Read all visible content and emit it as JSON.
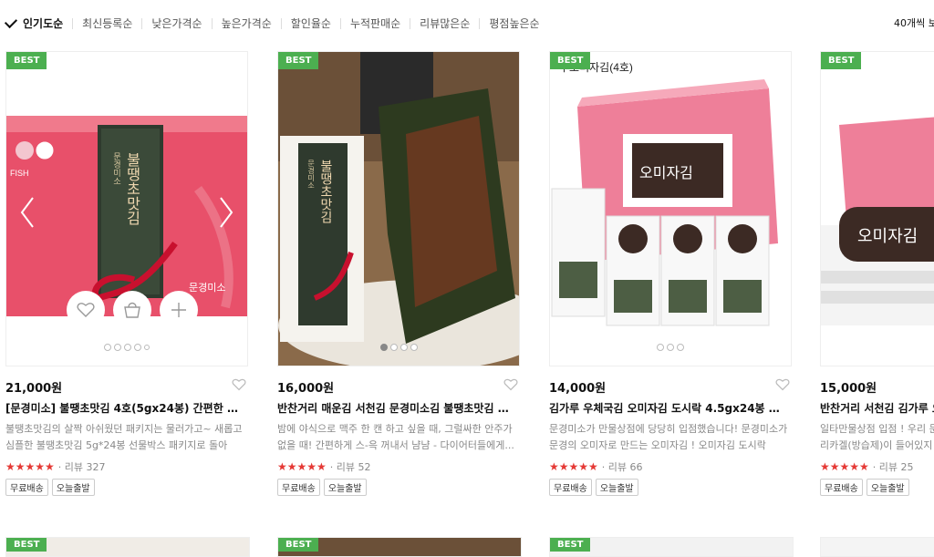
{
  "sort": {
    "items": [
      "인기도순",
      "최신등록순",
      "낮은가격순",
      "높은가격순",
      "할인율순",
      "누적판매순",
      "리뷰많은순",
      "평점높은순"
    ],
    "perpage": "40개씩 보"
  },
  "badge_label": "BEST",
  "colors": {
    "badge": "#4caf50",
    "stars": "#e53935"
  },
  "products": [
    {
      "price": "21,000원",
      "title": "[문경미소] 불땡초맛김 4호(5gx24봉) 간편한 밥반...",
      "desc1": "불땡초맛김의 살짝 아쉬웠던 패키지는 물러가고~ 새롭고",
      "desc2": "심플한 불땡초맛김 5g*24봉 선물박스 패키지로 돌아왔...",
      "stars": "★★★★★",
      "review": "· 리뷰 327",
      "tags": [
        "무료배송",
        "오늘출발"
      ]
    },
    {
      "price": "16,000원",
      "title": "반찬거리 매운김 서천김 문경미소김 불땡초맛김 5g...",
      "desc1": "밤에 야식으로 맥주 한 캔 하고 싶을 때, 그럴싸한 안주가",
      "desc2": "없을 때! 간편하게 스-윽 꺼내서 냠냠 - 다이어터들에게...",
      "stars": "★★★★★",
      "review": "· 리뷰 52",
      "tags": [
        "무료배송",
        "오늘출발"
      ]
    },
    {
      "price": "14,000원",
      "title": "김가루 우체국김 오미자김 도시락 4.5gx24봉 선물...",
      "desc1": "문경미소가 만물상점에 당당히 입점했습니다! 문경미소가",
      "desc2": "문경의 오미자로 만드는 오미자김 ! 오미자김 도시락 24...",
      "stars": "★★★★★",
      "review": "· 리뷰 66",
      "tags": [
        "무료배송",
        "오늘출발"
      ],
      "image_text": "우오미자김(4호)"
    },
    {
      "price": "15,000원",
      "title": "반찬거리 서천김 김가루 오",
      "desc1": "일타만물상점 입점 ! 우리 문",
      "desc2": "리카겔(방습제)이 들어있지",
      "stars": "★★★★★",
      "review": "· 리뷰 25",
      "tags": [
        "무료배송",
        "오늘출발"
      ]
    }
  ],
  "image_labels": {
    "p1_logo": "FISH",
    "p1_main": "불땡초맛김",
    "p1_sub": "문경미소",
    "p1_brand": "문경미소",
    "p2_main": "불땡초맛김",
    "p2_sub": "문경미소",
    "p3_main": "오미자김",
    "p4_main": "오미자김"
  }
}
